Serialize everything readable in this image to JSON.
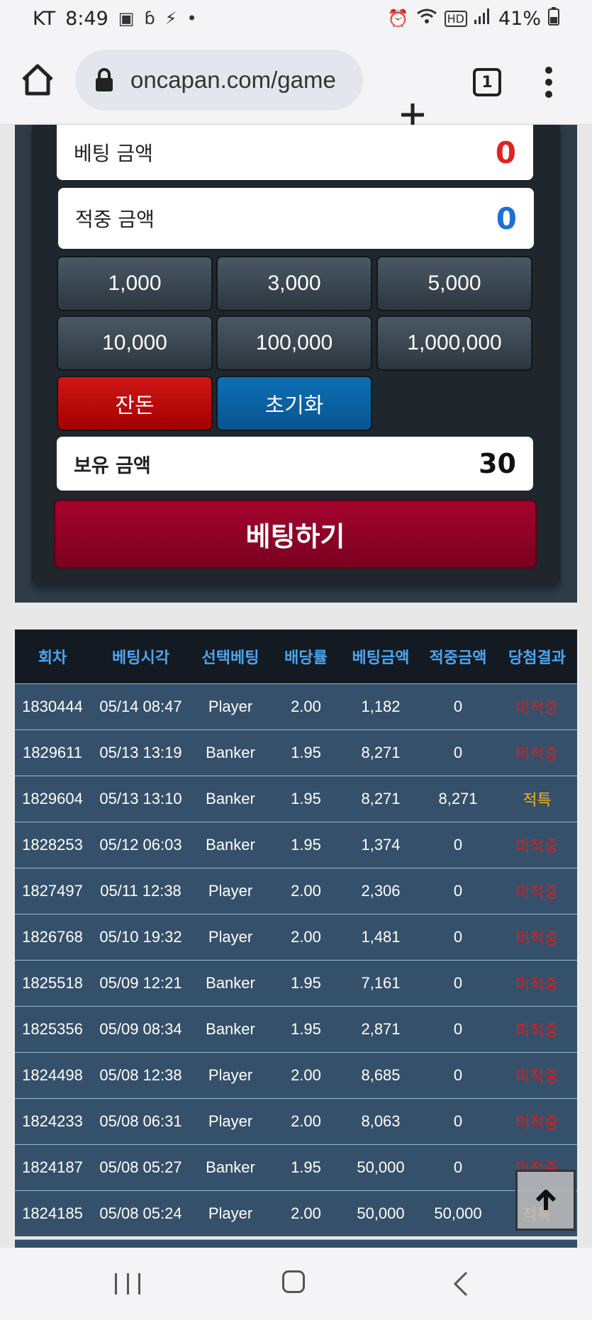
{
  "status": {
    "carrier": "KT",
    "time": "8:49",
    "battery": "41%"
  },
  "browser": {
    "url": "oncapan.com/game",
    "tab_count": "1"
  },
  "bet_panel": {
    "bet_amount_label": "베팅 금액",
    "bet_amount_value": "0",
    "win_amount_label": "적중 금액",
    "win_amount_value": "0",
    "chips": [
      "1,000",
      "3,000",
      "5,000",
      "10,000",
      "100,000",
      "1,000,000"
    ],
    "balance_button": "잔돈",
    "reset_button": "초기화",
    "balance_label": "보유 금액",
    "balance_value": "30",
    "submit_label": "베팅하기"
  },
  "history": {
    "columns": [
      "회차",
      "베팅시각",
      "선택베팅",
      "배당률",
      "베팅금액",
      "적중금액",
      "당첨결과"
    ],
    "rows": [
      [
        "1830444",
        "05/14 08:47",
        "Player",
        "2.00",
        "1,182",
        "0",
        "미적중"
      ],
      [
        "1829611",
        "05/13 13:19",
        "Banker",
        "1.95",
        "8,271",
        "0",
        "미적중"
      ],
      [
        "1829604",
        "05/13 13:10",
        "Banker",
        "1.95",
        "8,271",
        "8,271",
        "적특"
      ],
      [
        "1828253",
        "05/12 06:03",
        "Banker",
        "1.95",
        "1,374",
        "0",
        "미적중"
      ],
      [
        "1827497",
        "05/11 12:38",
        "Player",
        "2.00",
        "2,306",
        "0",
        "미적중"
      ],
      [
        "1826768",
        "05/10 19:32",
        "Player",
        "2.00",
        "1,481",
        "0",
        "미적중"
      ],
      [
        "1825518",
        "05/09 12:21",
        "Banker",
        "1.95",
        "7,161",
        "0",
        "미적중"
      ],
      [
        "1825356",
        "05/09 08:34",
        "Banker",
        "1.95",
        "2,871",
        "0",
        "미적중"
      ],
      [
        "1824498",
        "05/08 12:38",
        "Player",
        "2.00",
        "8,685",
        "0",
        "미적중"
      ],
      [
        "1824233",
        "05/08 06:31",
        "Player",
        "2.00",
        "8,063",
        "0",
        "미적중"
      ],
      [
        "1824187",
        "05/08 05:27",
        "Banker",
        "1.95",
        "50,000",
        "0",
        "미적중"
      ],
      [
        "1824185",
        "05/08 05:24",
        "Player",
        "2.00",
        "50,000",
        "50,000",
        "적특"
      ]
    ]
  },
  "colors": {
    "lose": "#d81e1e",
    "win": "#f2b21c",
    "header_text": "#4aa6f2"
  }
}
